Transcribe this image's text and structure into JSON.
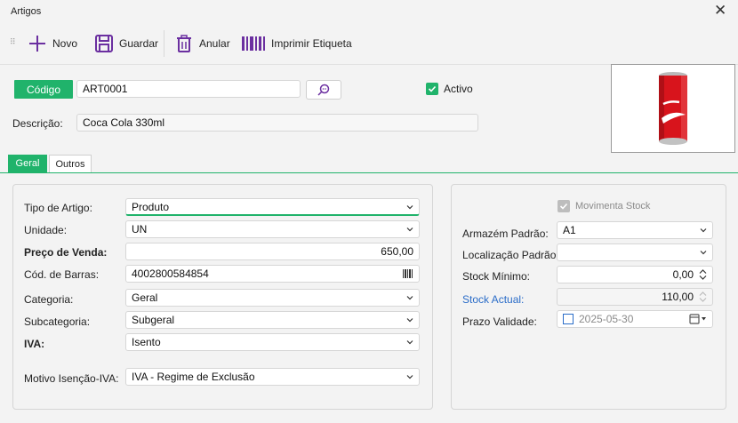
{
  "window": {
    "title": "Artigos"
  },
  "toolbar": {
    "novo": "Novo",
    "guardar": "Guardar",
    "anular": "Anular",
    "imprimir": "Imprimir Etiqueta"
  },
  "header": {
    "codigo_label": "Código",
    "codigo_value": "ART0001",
    "descricao_label": "Descrição:",
    "descricao_value": "Coca Cola 330ml",
    "activo_label": "Activo"
  },
  "tabs": [
    {
      "label": "Geral"
    },
    {
      "label": "Outros"
    }
  ],
  "left": {
    "tipo_label": "Tipo de Artigo:",
    "tipo_value": "Produto",
    "unidade_label": "Unidade:",
    "unidade_value": "UN",
    "preco_label": "Preço de Venda:",
    "preco_value": "650,00",
    "barras_label": "Cód. de Barras:",
    "barras_value": "4002800584854",
    "categoria_label": "Categoria:",
    "categoria_value": "Geral",
    "subcategoria_label": "Subcategoria:",
    "subcategoria_value": "Subgeral",
    "iva_label": "IVA:",
    "iva_value": "Isento",
    "motivo_label": "Motivo Isenção-IVA:",
    "motivo_value": "IVA - Regime de Exclusão"
  },
  "right": {
    "movimenta_label": "Movimenta Stock",
    "armazem_label": "Armazém Padrão:",
    "armazem_value": "A1",
    "localizacao_label": "Localização Padrão:",
    "localizacao_value": "",
    "minimo_label": "Stock Mínimo:",
    "minimo_value": "0,00",
    "actual_label": "Stock Actual:",
    "actual_value": "110,00",
    "prazo_label": "Prazo Validade:",
    "prazo_value": "2025-05-30"
  },
  "colors": {
    "accent": "#20b36b",
    "icon": "#6b2fa0",
    "link": "#2a6cc8"
  },
  "icons": [
    "plus-icon",
    "save-icon",
    "trash-icon",
    "barcode-icon",
    "search-icon",
    "close-icon",
    "check-icon",
    "chevron-down-icon",
    "spinner-icon",
    "calendar-icon"
  ]
}
